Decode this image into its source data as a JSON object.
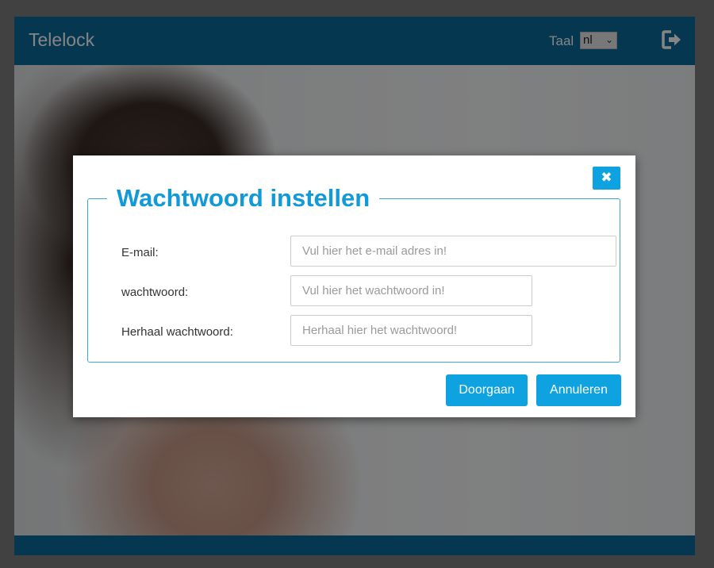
{
  "header": {
    "title": "Telelock",
    "language_label": "Taal",
    "language_value": "nl",
    "logout_icon": "logout-icon"
  },
  "dialog": {
    "title": "Wachtwoord instellen",
    "close_icon": "close-icon",
    "fields": [
      {
        "label": "E-mail:",
        "placeholder": "Vul hier het e-mail adres in!",
        "value": ""
      },
      {
        "label": "wachtwoord:",
        "placeholder": "Vul hier het wachtwoord in!",
        "value": ""
      },
      {
        "label": "Herhaal wachtwoord:",
        "placeholder": "Herhaal hier het wachtwoord!",
        "value": ""
      }
    ],
    "buttons": {
      "continue": "Doorgaan",
      "cancel": "Annuleren"
    }
  },
  "colors": {
    "header_bg": "#0a6a9c",
    "accent": "#0ea3e0",
    "title_text": "#1199d8"
  }
}
